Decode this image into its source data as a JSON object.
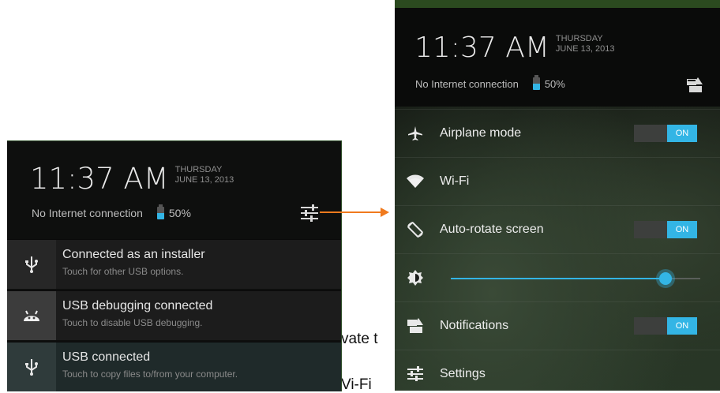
{
  "doc_fragments": {
    "fragment1": "vate t",
    "fragment2": "Vi-Fi"
  },
  "left_panel": {
    "time": "11:37 AM",
    "day": "THURSDAY",
    "date": "JUNE 13, 2013",
    "network_status": "No Internet connection",
    "battery": "50%",
    "notifications": [
      {
        "title": "Connected as an installer",
        "subtitle": "Touch for other USB options.",
        "icon": "usb-icon"
      },
      {
        "title": "USB debugging connected",
        "subtitle": "Touch to disable USB debugging.",
        "icon": "android-icon"
      },
      {
        "title": "USB connected",
        "subtitle": "Touch to copy files to/from your computer.",
        "icon": "usb-icon"
      }
    ]
  },
  "right_panel": {
    "time": "11:37 AM",
    "day": "THURSDAY",
    "date": "JUNE 13, 2013",
    "network_status": "No Internet connection",
    "battery": "50%",
    "quick_settings": {
      "airplane": {
        "label": "Airplane mode",
        "state": "ON"
      },
      "wifi": {
        "label": "Wi-Fi"
      },
      "autorotate": {
        "label": "Auto-rotate screen",
        "state": "ON"
      },
      "brightness": {
        "level": 0.86
      },
      "notifications": {
        "label": "Notifications",
        "state": "ON"
      },
      "settings": {
        "label": "Settings"
      }
    }
  },
  "colors": {
    "accent": "#33b5e5",
    "arrow": "#f07a1e"
  }
}
